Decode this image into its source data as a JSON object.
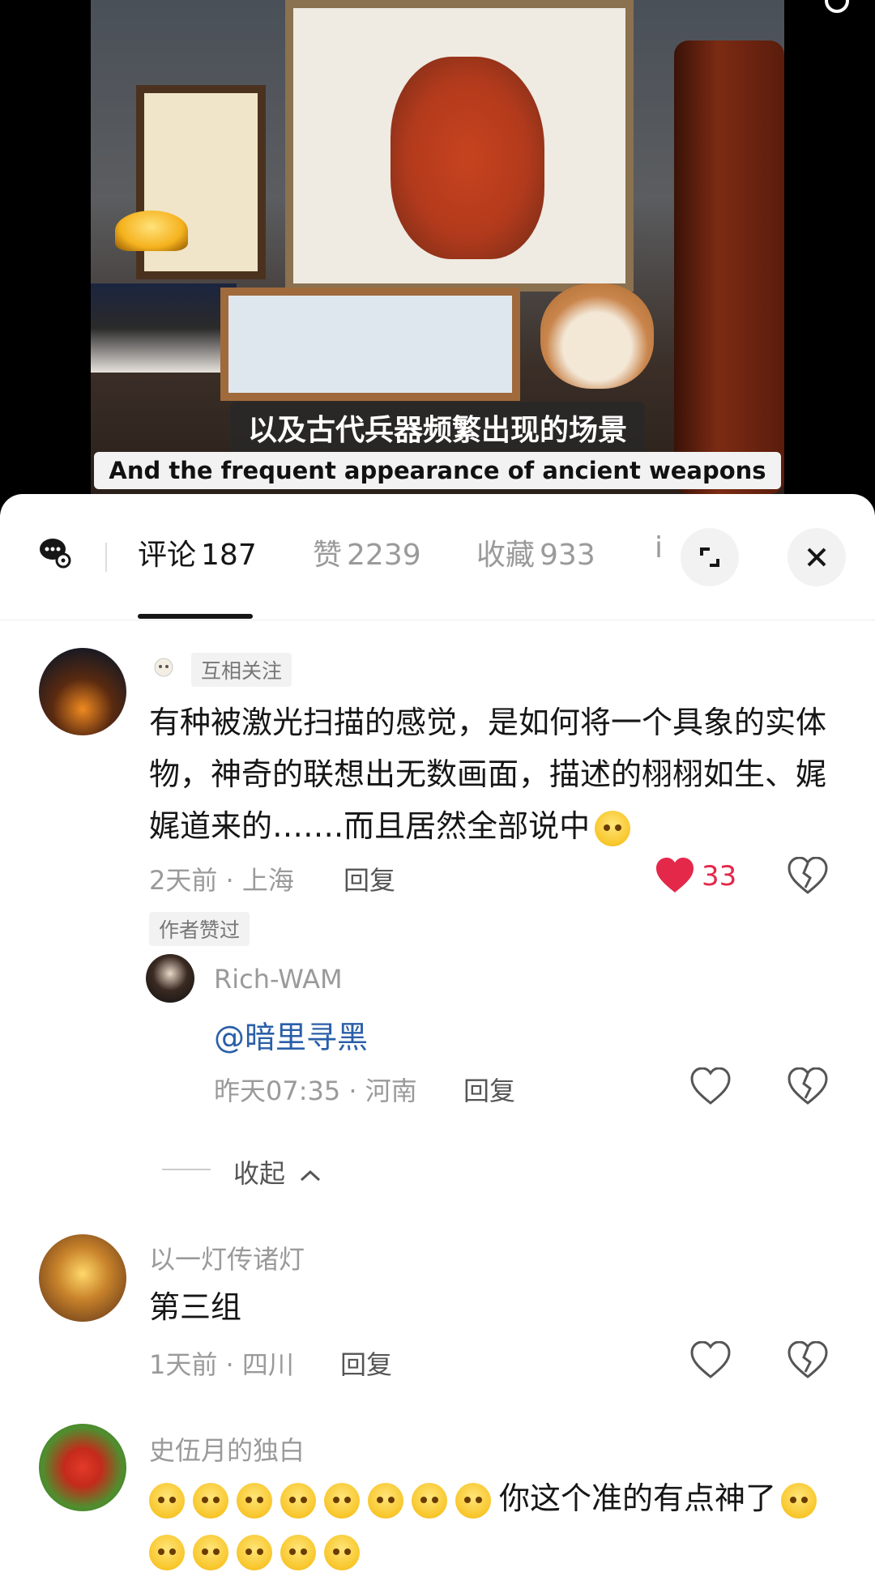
{
  "video": {
    "caption_zh": "以及古代兵器频繁出现的场景",
    "caption_en": "And the frequent appearance of ancient weapons",
    "search_icon": "search-icon"
  },
  "tabs": {
    "comments_label": "评论",
    "comments_count": "187",
    "likes_label": "赞",
    "likes_count": "2239",
    "favorites_label": "收藏",
    "favorites_count": "933",
    "more_label": "i",
    "expand_icon": "expand-icon",
    "close_icon": "close-icon"
  },
  "comments": [
    {
      "tag": "互相关注",
      "text": "有种被激光扫描的感觉，是如何将一个具象的实体物，神奇的联想出无数画面，描述的栩栩如生、娓娓道来的…….而且居然全部说中",
      "time_location": "2天前 · 上海",
      "reply_label": "回复",
      "likes": "33",
      "author_badge": "作者赞过",
      "reply": {
        "name": "Rich-WAM",
        "mention": "@暗里寻黑",
        "time_location": "昨天07:35 · 河南",
        "reply_label": "回复"
      }
    },
    {
      "name": "以一灯传诸灯",
      "text": "第三组",
      "time_location": "1天前 · 四川",
      "reply_label": "回复"
    },
    {
      "name": "史伍月的独白",
      "text": "你这个准的有点神了"
    }
  ],
  "collapse_label": "收起",
  "colors": {
    "like_red": "#e4284a",
    "mention_blue": "#2a5fa8"
  }
}
